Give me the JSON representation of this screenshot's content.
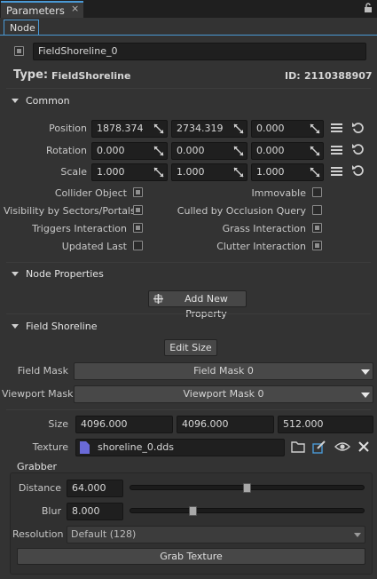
{
  "window": {
    "tab_title": "Parameters",
    "tab_close": "×",
    "subtab": "Node"
  },
  "node": {
    "name": "FieldShoreline_0",
    "type_label": "Type:",
    "type_value": "FieldShoreline",
    "id_label": "ID:",
    "id_value": "2110388907"
  },
  "common": {
    "title": "Common",
    "position": {
      "label": "Position",
      "x": "1878.374",
      "y": "2734.319",
      "z": "0.000"
    },
    "rotation": {
      "label": "Rotation",
      "x": "0.000",
      "y": "0.000",
      "z": "0.000"
    },
    "scale": {
      "label": "Scale",
      "x": "1.000",
      "y": "1.000",
      "z": "1.000"
    },
    "flags": [
      {
        "label": "Collider Object",
        "checked": true
      },
      {
        "label": "Immovable",
        "checked": false
      },
      {
        "label": "Visibility by Sectors/Portals",
        "checked": true
      },
      {
        "label": "Culled by Occlusion Query",
        "checked": false
      },
      {
        "label": "Triggers Interaction",
        "checked": true
      },
      {
        "label": "Grass Interaction",
        "checked": true
      },
      {
        "label": "Updated Last",
        "checked": false
      },
      {
        "label": "Clutter Interaction",
        "checked": true
      }
    ]
  },
  "node_properties": {
    "title": "Node Properties",
    "add_button": "Add New Property"
  },
  "field_shoreline": {
    "title": "Field Shoreline",
    "edit_size_button": "Edit Size",
    "field_mask_label": "Field Mask",
    "field_mask_value": "Field Mask 0",
    "viewport_mask_label": "Viewport Mask",
    "viewport_mask_value": "Viewport Mask 0",
    "size_label": "Size",
    "size_x": "4096.000",
    "size_y": "4096.000",
    "size_z": "512.000",
    "texture_label": "Texture",
    "texture_value": "shoreline_0.dds",
    "grabber": {
      "title": "Grabber",
      "distance_label": "Distance",
      "distance_value": "64.000",
      "distance_fraction": 0.5,
      "blur_label": "Blur",
      "blur_value": "8.000",
      "blur_fraction": 0.26,
      "resolution_label": "Resolution",
      "resolution_value": "Default (128)",
      "grab_button": "Grab Texture"
    }
  },
  "colors": {
    "accent": "#4a9ad6",
    "background": "#333333",
    "field_bg": "#1f1f1f"
  }
}
